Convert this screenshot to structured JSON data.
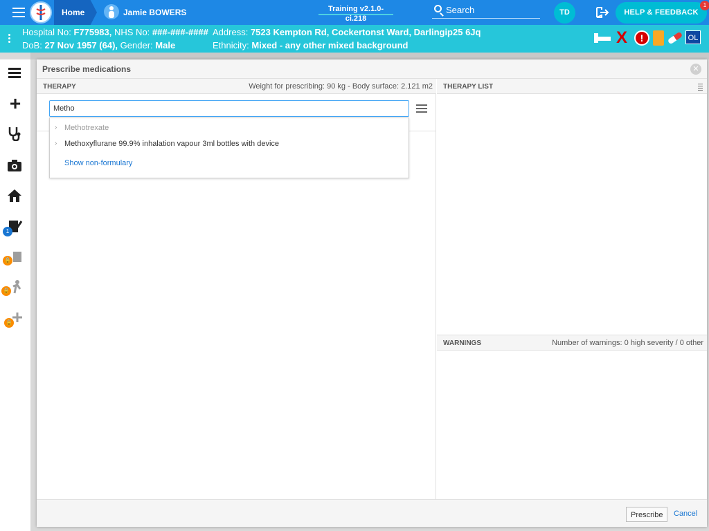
{
  "topbar": {
    "home_label": "Home",
    "patient_name": "Jamie BOWERS",
    "environment": "Training v2.1.0-ci.218",
    "search_label": "Search",
    "user_initials": "TD",
    "help_label": "HELP & FEEDBACK",
    "help_badge": "1"
  },
  "banner": {
    "hospital_no_label": "Hospital No:",
    "hospital_no": "F775983,",
    "nhs_no_label": "NHS No:",
    "nhs_no": "###-###-####",
    "dob_label": "DoB:",
    "dob": "27 Nov 1957 (64),",
    "gender_label": "Gender:",
    "gender": "Male",
    "address_label": "Address:",
    "address": "7523 Kempton Rd, Cockertonst Ward, Darlingip25 6Jq",
    "ethnicity_label": "Ethnicity:",
    "ethnicity": "Mixed - any other mixed background",
    "alert_glyph": "!",
    "x_glyph": "X",
    "ol_label": "OL"
  },
  "rail": {
    "badge_count": "1"
  },
  "modal": {
    "title": "Prescribe medications",
    "close_glyph": "✕",
    "therapy": {
      "title": "THERAPY",
      "meta": "Weight for prescribing: 90 kg - Body surface: 2.121 m2",
      "search_value": "Metho",
      "results": [
        {
          "label": "Methotrexate"
        },
        {
          "label": "Methoxyflurane 99.9% inhalation vapour 3ml bottles with device"
        }
      ],
      "show_non_formulary": "Show non-formulary"
    },
    "therapy_list": {
      "title": "THERAPY LIST"
    },
    "warnings": {
      "title": "WARNINGS",
      "summary": "Number of warnings: 0 high severity / 0 other"
    },
    "footer": {
      "prescribe_label": "Prescribe",
      "cancel_label": "Cancel"
    }
  },
  "colors": {
    "topbar": "#1e88e5",
    "banner": "#26c6da",
    "accent": "#00bcd4",
    "link": "#1976d2"
  }
}
